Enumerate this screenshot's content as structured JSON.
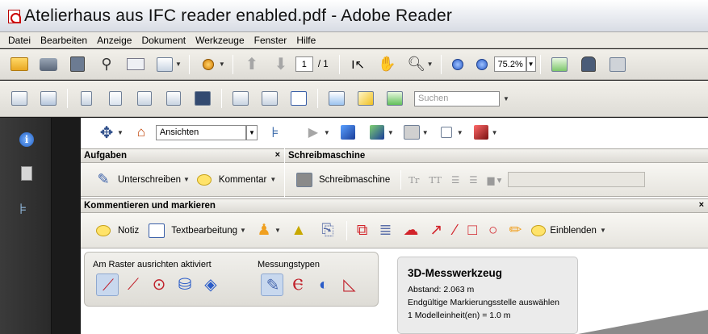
{
  "window": {
    "title": "Atelierhaus aus IFC reader enabled.pdf - Adobe Reader"
  },
  "menu": [
    "Datei",
    "Bearbeiten",
    "Anzeige",
    "Dokument",
    "Werkzeuge",
    "Fenster",
    "Hilfe"
  ],
  "toolbar": {
    "page_current": "1",
    "page_total": "/ 1",
    "zoom": "75.2%",
    "search_placeholder": "Suchen"
  },
  "view3d": {
    "views_value": "Ansichten"
  },
  "aufgaben": {
    "header": "Aufgaben",
    "close": "×",
    "sign_label": "Unterschreiben",
    "comment_label": "Kommentar"
  },
  "schreibmaschine": {
    "header": "Schreibmaschine",
    "button_label": "Schreibmaschine"
  },
  "kommentieren": {
    "header": "Kommentieren und markieren",
    "close": "×",
    "note_label": "Notiz",
    "textedit_label": "Textbearbeitung",
    "show_label": "Einblenden"
  },
  "raster": {
    "snap_label": "Am Raster ausrichten aktiviert",
    "types_label": "Messungstypen"
  },
  "measure": {
    "title": "3D-Messwerkzeug",
    "distance": "Abstand: 2.063 m",
    "instruction": "Endgültige Markierungsstelle auswählen",
    "unit": "1 Modelleinheit(en) = 1.0 m"
  }
}
